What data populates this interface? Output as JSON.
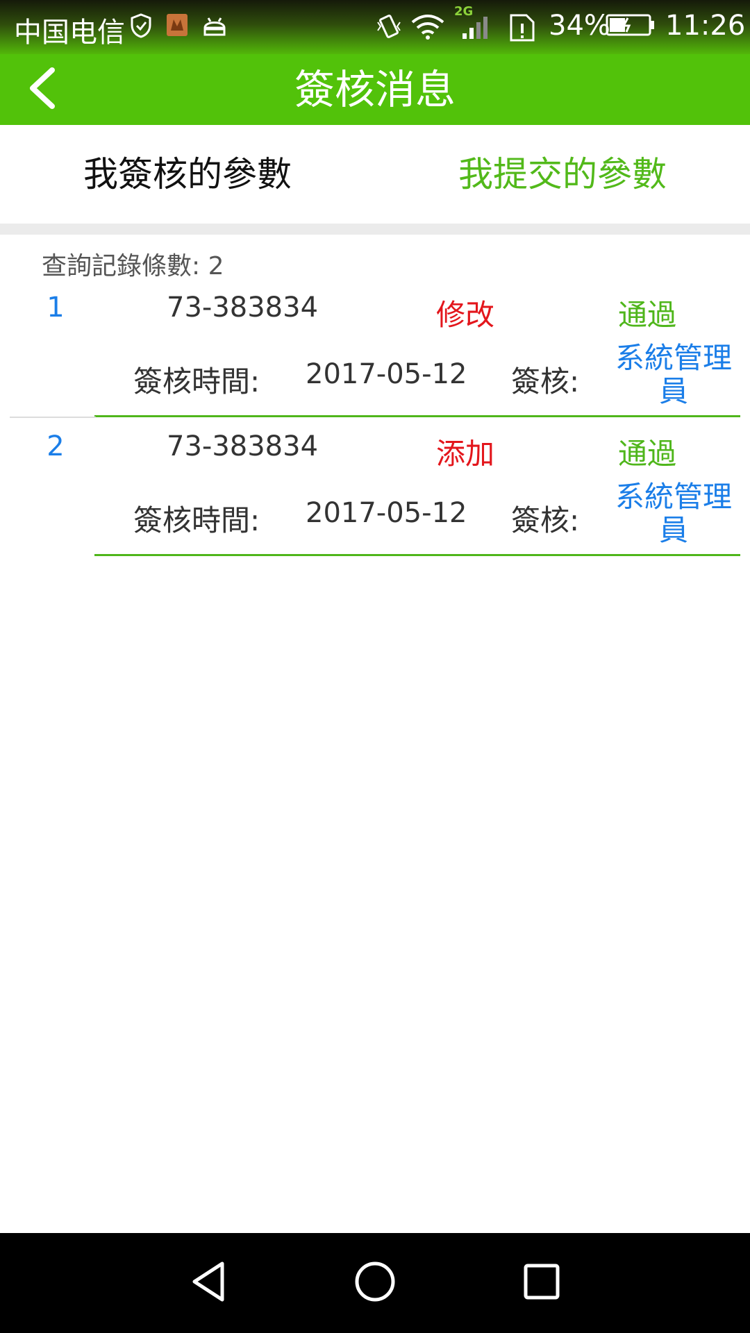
{
  "status_bar": {
    "carrier": "中国电信",
    "network": "2G",
    "battery": "34%",
    "time": "11:26"
  },
  "header": {
    "title": "簽核消息",
    "back_icon": "chevron-left-icon"
  },
  "tabs": [
    {
      "label": "我簽核的參數",
      "selected": true
    },
    {
      "label": "我提交的參數",
      "selected": false
    }
  ],
  "list": {
    "count_label": "查詢記錄條數:",
    "count_value": "2",
    "records": [
      {
        "index": "1",
        "code": "73-383834",
        "action": "修改",
        "status": "通過",
        "time_label": "簽核時間:",
        "time": "2017-05-12",
        "reviewer_label": "簽核:",
        "reviewer": "系統管理員"
      },
      {
        "index": "2",
        "code": "73-383834",
        "action": "添加",
        "status": "通過",
        "time_label": "簽核時間:",
        "time": "2017-05-12",
        "reviewer_label": "簽核:",
        "reviewer": "系統管理員"
      }
    ]
  },
  "colors": {
    "header_green": "#52c20a",
    "tab_selected_green": "#52b91a",
    "action_red": "#e3161c",
    "link_blue": "#1b7ee8"
  }
}
